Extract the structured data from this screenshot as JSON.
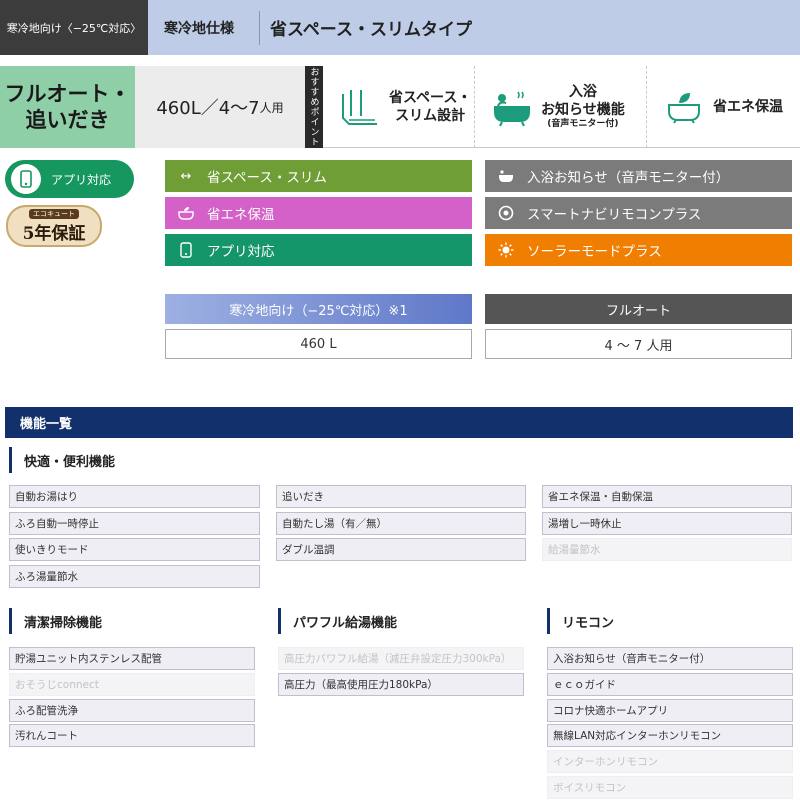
{
  "header": {
    "cold_region_label": "寒冷地向け〈−25℃対応〉",
    "spec_label": "寒冷地仕様",
    "type_label": "省スペース・スリムタイプ"
  },
  "band": {
    "full_auto": [
      "フルオート・",
      "追いだき"
    ],
    "capacity": "460L／4〜7",
    "capacity_unit": "人用",
    "recommend_label": "おすすめポイント",
    "features": [
      {
        "icon": "slim-unit-icon",
        "lines": [
          "省スペース・",
          "スリム設計"
        ],
        "sub": ""
      },
      {
        "icon": "bath-notify-icon",
        "lines": [
          "入浴",
          "お知らせ機能"
        ],
        "sub": "(音声モニター付)"
      },
      {
        "icon": "eco-bath-icon",
        "lines": [
          "省エネ保温"
        ],
        "sub": ""
      }
    ]
  },
  "badges": {
    "app": "アプリ対応",
    "warranty_top": "エコキュート",
    "warranty_main": "5年保証"
  },
  "feature_buttons": [
    {
      "label": "省スペース・スリム",
      "icon": "arrows-icon",
      "color": "#6f9d36"
    },
    {
      "label": "省エネ保温",
      "icon": "eco-bath-icon",
      "color": "#d461c7"
    },
    {
      "label": "アプリ対応",
      "icon": "app-icon",
      "color": "#14966a"
    },
    {
      "label": "入浴お知らせ（音声モニター付）",
      "icon": "bath-notify-icon",
      "color": "#7b7b7b"
    },
    {
      "label": "スマートナビリモコンプラス",
      "icon": "remote-icon",
      "color": "#7b7b7b"
    },
    {
      "label": "ソーラーモードプラス",
      "icon": "sun-icon",
      "color": "#f07e00"
    }
  ],
  "spec": {
    "cold_head": "寒冷地向け（−25℃対応）※1",
    "cold_value": "460 L",
    "auto_head": "フルオート",
    "auto_value": "4 〜 7 人用",
    "cold_color": "#7e94d4",
    "auto_color": "#555555"
  },
  "functions": {
    "title": "機能一覧",
    "comfort": {
      "label": "快適・便利機能",
      "col1": [
        {
          "text": "自動お湯はり",
          "on": true
        },
        {
          "text": "ふろ自動一時停止",
          "on": true
        },
        {
          "text": "使いきりモード",
          "on": true
        },
        {
          "text": "ふろ湯量節水",
          "on": true
        }
      ],
      "col2": [
        {
          "text": "追いだき",
          "on": true
        },
        {
          "text": "自動たし湯（有／無）",
          "on": true
        },
        {
          "text": "ダブル温調",
          "on": true
        }
      ],
      "col3": [
        {
          "text": "省エネ保温・自動保温",
          "on": true
        },
        {
          "text": "湯増し一時休止",
          "on": true
        },
        {
          "text": "給湯量節水",
          "on": false
        }
      ]
    },
    "cleaning": {
      "label": "清潔掃除機能",
      "items": [
        {
          "text": "貯湯ユニット内ステンレス配管",
          "on": true
        },
        {
          "text": "おそうじconnect",
          "on": false
        },
        {
          "text": "ふろ配管洗浄",
          "on": true
        },
        {
          "text": "汚れんコート",
          "on": true
        }
      ]
    },
    "powerful": {
      "label": "パワフル給湯機能",
      "items": [
        {
          "text": "高圧力パワフル給湯（減圧弁設定圧力300kPa）",
          "on": false
        },
        {
          "text": "高圧力（最高使用圧力180kPa）",
          "on": true
        }
      ]
    },
    "remote": {
      "label": "リモコン",
      "items": [
        {
          "text": "入浴お知らせ（音声モニター付）",
          "on": true
        },
        {
          "text": "ｅｃｏガイド",
          "on": true
        },
        {
          "text": "コロナ快適ホームアプリ",
          "on": true
        },
        {
          "text": "無線LAN対応インターホンリモコン",
          "on": true
        },
        {
          "text": "インターホンリモコン",
          "on": false
        },
        {
          "text": "ボイスリモコン",
          "on": false
        }
      ]
    }
  }
}
